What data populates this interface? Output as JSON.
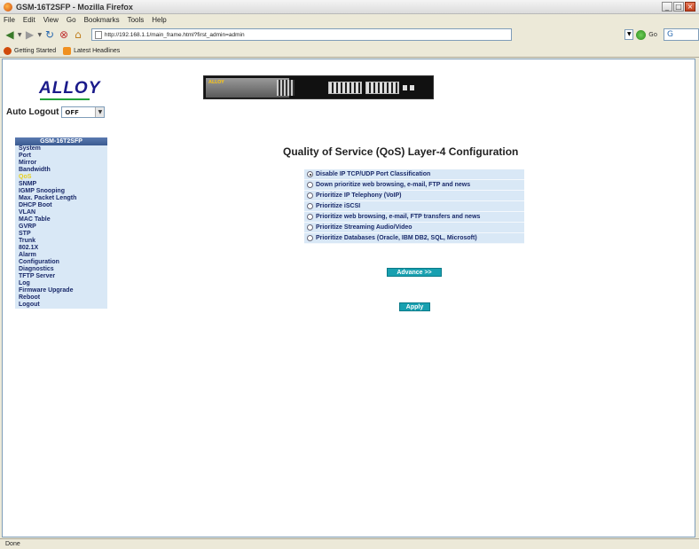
{
  "window": {
    "title": "GSM-16T2SFP - Mozilla Firefox"
  },
  "menu": [
    "File",
    "Edit",
    "View",
    "Go",
    "Bookmarks",
    "Tools",
    "Help"
  ],
  "address": {
    "url": "http://192.168.1.1/main_frame.html?first_admin=admin",
    "go_label": "Go"
  },
  "bookmarks": [
    "Getting Started",
    "Latest Headlines"
  ],
  "logo": {
    "text": "ALLOY"
  },
  "auto_logout": {
    "label": "Auto Logout",
    "value": "OFF"
  },
  "device": {
    "brand": "ALLOY"
  },
  "sidebar": {
    "header": "GSM-16T2SFP",
    "items": [
      "System",
      "Port",
      "Mirror",
      "Bandwidth",
      "QoS",
      "SNMP",
      "IGMP Snooping",
      "Max. Packet Length",
      "DHCP Boot",
      "VLAN",
      "MAC Table",
      "GVRP",
      "STP",
      "Trunk",
      "802.1X",
      "Alarm",
      "Configuration",
      "Diagnostics",
      "TFTP Server",
      "Log",
      "Firmware Upgrade",
      "Reboot",
      "Logout"
    ],
    "active": "QoS"
  },
  "page": {
    "title": "Quality of Service (QoS) Layer-4 Configuration",
    "options": [
      {
        "label": "Disable IP TCP/UDP Port Classification",
        "checked": true
      },
      {
        "label": "Down prioritize web browsing, e-mail, FTP and news",
        "checked": false
      },
      {
        "label": "Prioritize IP Telephony (VoIP)",
        "checked": false
      },
      {
        "label": "Prioritize iSCSI",
        "checked": false
      },
      {
        "label": "Prioritize web browsing, e-mail, FTP transfers and news",
        "checked": false
      },
      {
        "label": "Prioritize Streaming Audio/Video",
        "checked": false
      },
      {
        "label": "Prioritize Databases (Oracle, IBM DB2, SQL, Microsoft)",
        "checked": false
      }
    ],
    "advance_label": "Advance >>",
    "apply_label": "Apply"
  },
  "status": "Done"
}
